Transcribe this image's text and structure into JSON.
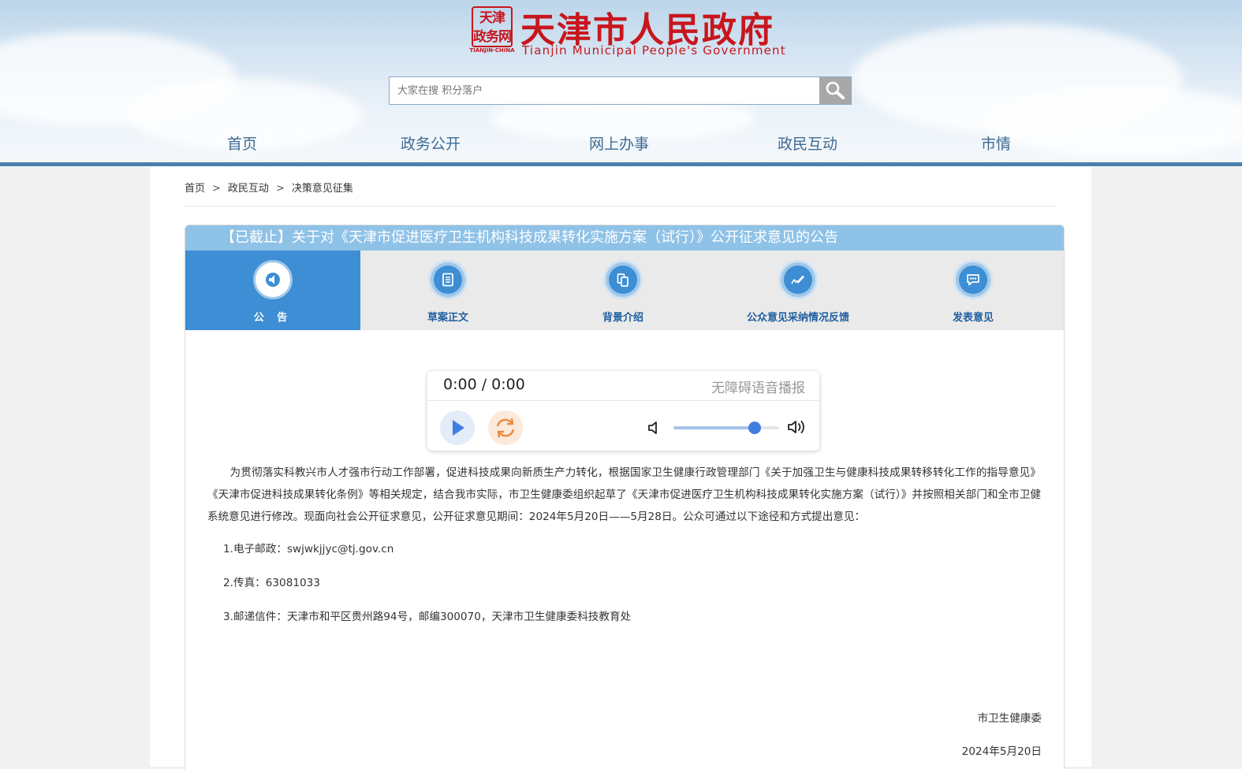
{
  "header": {
    "site_title": "天津市人民政府",
    "site_title_en": "Tianjin Municipal People's Government",
    "seal_text": "天津政务网",
    "seal_sub": "TIANJIN·CHINA",
    "brand_color": "#c8161d"
  },
  "search": {
    "placeholder": "大家在搜 积分落户",
    "icon": "search-icon"
  },
  "nav": {
    "items": [
      "首页",
      "政务公开",
      "网上办事",
      "政民互动",
      "市情"
    ]
  },
  "breadcrumb": {
    "items": [
      "首页",
      "政民互动",
      "决策意见征集"
    ],
    "separator": ">"
  },
  "notice": {
    "title": "【已截止】关于对《天津市促进医疗卫生机构科技成果转化实施方案（试行）》公开征求意见的公告",
    "tabs": [
      {
        "label": "公 告",
        "icon": "speaker-icon",
        "active": true
      },
      {
        "label": "草案正文",
        "icon": "document-icon",
        "active": false
      },
      {
        "label": "背景介绍",
        "icon": "copy-icon",
        "active": false
      },
      {
        "label": "公众意见采纳情况反馈",
        "icon": "feedback-edit-icon",
        "active": false
      },
      {
        "label": "发表意见",
        "icon": "chat-bubble-icon",
        "active": false
      }
    ]
  },
  "player": {
    "time": "0:00 / 0:00",
    "caption": "无障碍语音播报",
    "volume": 0.77
  },
  "article": {
    "paragraph": "为贯彻落实科教兴市人才强市行动工作部署，促进科技成果向新质生产力转化，根据国家卫生健康行政管理部门《关于加强卫生与健康科技成果转移转化工作的指导意见》《天津市促进科技成果转化条例》等相关规定，结合我市实际，市卫生健康委组织起草了《天津市促进医疗卫生机构科技成果转化实施方案（试行）》并按照相关部门和全市卫健系统意见进行修改。现面向社会公开征求意见，公开征求意见期间：2024年5月20日——5月28日。公众可通过以下途径和方式提出意见：",
    "items": [
      "1.电子邮政：swjwkjjyc@tj.gov.cn",
      "2.传真：63081033",
      "3.邮递信件：天津市和平区贵州路94号，邮编300070，天津市卫生健康委科技教育处"
    ],
    "signature": "市卫生健康委",
    "date": "2024年5月20日"
  }
}
